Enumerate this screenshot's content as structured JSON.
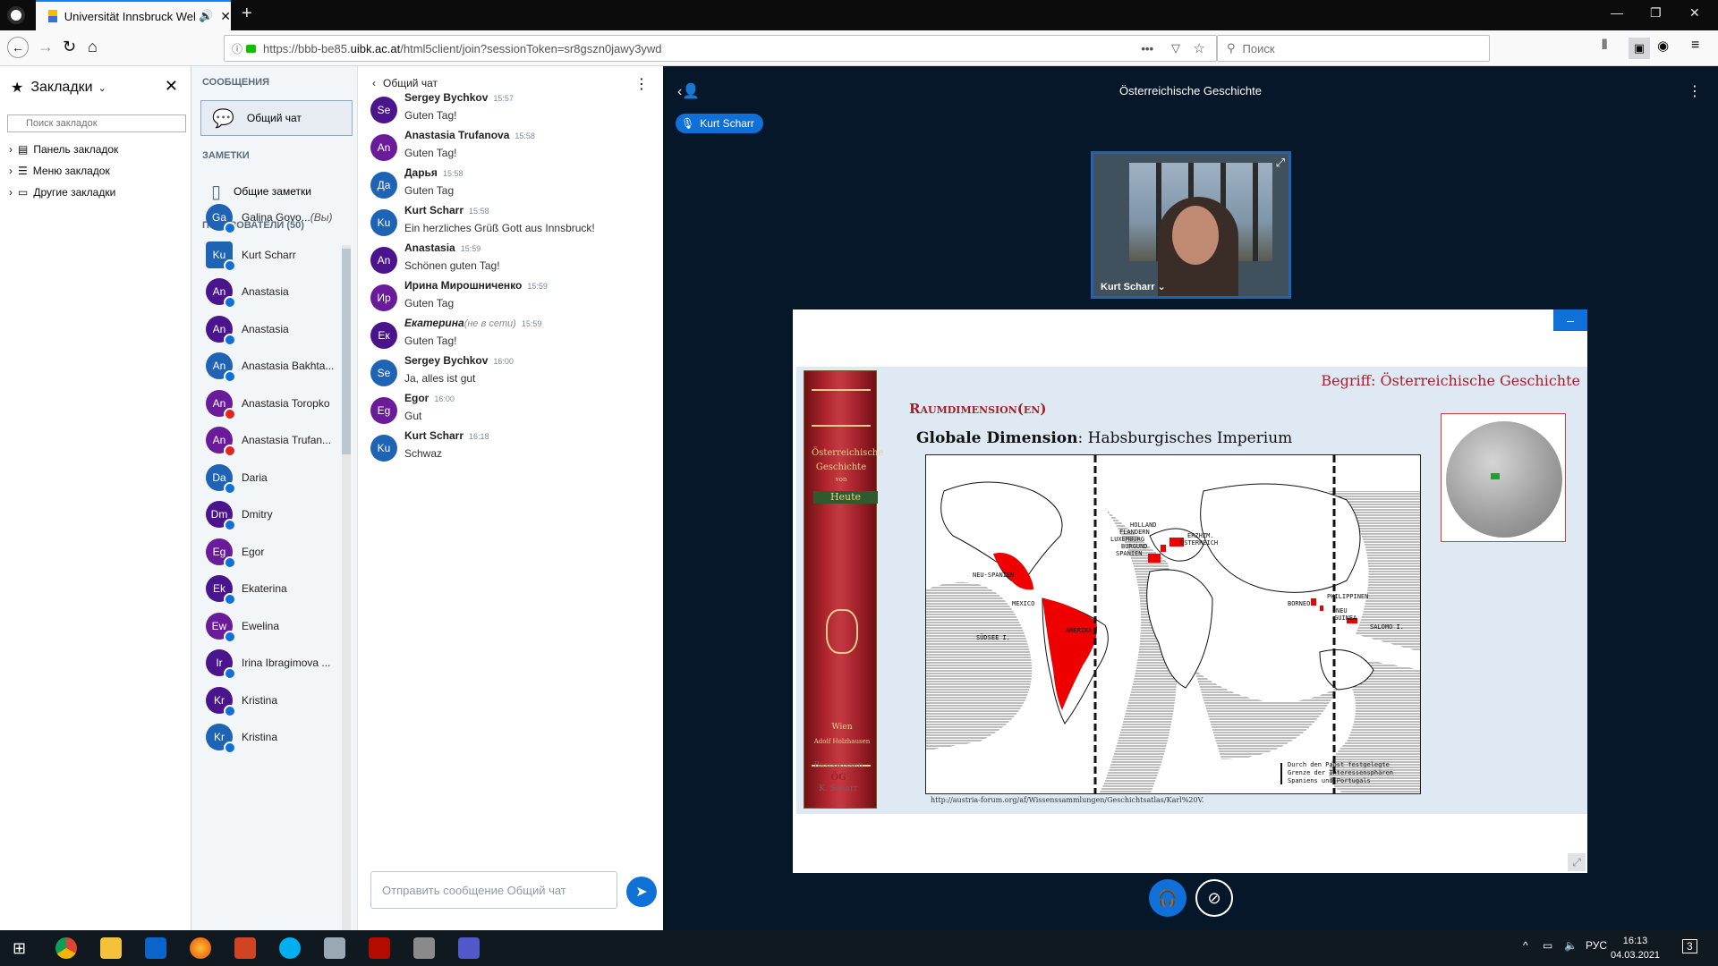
{
  "browser": {
    "tab_title": "Universität Innsbruck Webc",
    "url_prefix": "https://bbb-be85.",
    "url_host": "uibk.ac.at",
    "url_suffix": "/html5client/join?sessionToken=sr8gszn0jawy3ywd",
    "search_placeholder": "Поиск",
    "url_more": "•••"
  },
  "bookmarks": {
    "title": "Закладки",
    "search_placeholder": "Поиск закладок",
    "items": [
      "Панель закладок",
      "Меню закладок",
      "Другие закладки"
    ]
  },
  "bbb_left": {
    "messages_header": "СООБЩЕНИЯ",
    "public_chat": "Общий чат",
    "notes_header": "ЗАМЕТКИ",
    "shared_notes": "Общие заметки",
    "users_header": "ПОЛЬЗОВАТЕЛИ (50)",
    "users": [
      {
        "initials": "Ga",
        "name": "Galina Govo...",
        "suffix": "(Вы)",
        "color": "#1f63b5",
        "status": "blue"
      },
      {
        "initials": "Ku",
        "name": "Kurt Scharr",
        "suffix": "",
        "color": "#1f63b5",
        "status": "blue",
        "presenter": true
      },
      {
        "initials": "An",
        "name": "Anastasia",
        "suffix": "",
        "color": "#4a148c",
        "status": "blue"
      },
      {
        "initials": "An",
        "name": "Anastasia",
        "suffix": "",
        "color": "#4a148c",
        "status": "blue"
      },
      {
        "initials": "An",
        "name": "Anastasia Bakhta...",
        "suffix": "",
        "color": "#1f63b5",
        "status": "blue"
      },
      {
        "initials": "An",
        "name": "Anastasia Toropko",
        "suffix": "",
        "color": "#6a1b9a",
        "status": "red"
      },
      {
        "initials": "An",
        "name": "Anastasia Trufan...",
        "suffix": "",
        "color": "#6a1b9a",
        "status": "red"
      },
      {
        "initials": "Da",
        "name": "Daria",
        "suffix": "",
        "color": "#1f63b5",
        "status": "blue"
      },
      {
        "initials": "Dm",
        "name": "Dmitry",
        "suffix": "",
        "color": "#4a148c",
        "status": "blue"
      },
      {
        "initials": "Eg",
        "name": "Egor",
        "suffix": "",
        "color": "#6a1b9a",
        "status": "blue"
      },
      {
        "initials": "Ek",
        "name": "Ekaterina",
        "suffix": "",
        "color": "#4a148c",
        "status": "blue"
      },
      {
        "initials": "Ew",
        "name": "Ewelina",
        "suffix": "",
        "color": "#6a1b9a",
        "status": "blue"
      },
      {
        "initials": "Ir",
        "name": "Irina Ibragimova ...",
        "suffix": "",
        "color": "#4a148c",
        "status": "blue"
      },
      {
        "initials": "Kr",
        "name": "Kristina",
        "suffix": "",
        "color": "#4a148c",
        "status": "blue"
      },
      {
        "initials": "Kr",
        "name": "Kristina",
        "suffix": "",
        "color": "#1f63b5",
        "status": "blue"
      }
    ]
  },
  "chat": {
    "title": "Общий чат",
    "input_placeholder": "Отправить сообщение Общий чат",
    "messages": [
      {
        "initials": "Se",
        "name": "Sergey Bychkov",
        "time": "15:57",
        "text": "Guten Tag!",
        "color": "#4a148c",
        "offline": ""
      },
      {
        "initials": "An",
        "name": "Anastasia Trufanova",
        "time": "15:58",
        "text": "Guten Tag!",
        "color": "#6a1b9a",
        "offline": ""
      },
      {
        "initials": "Да",
        "name": "Дарья",
        "time": "15:58",
        "text": "Guten Tag",
        "color": "#1f63b5",
        "offline": ""
      },
      {
        "initials": "Ku",
        "name": "Kurt Scharr",
        "time": "15:58",
        "text": "Ein herzliches Grüß Gott aus Innsbruck!",
        "color": "#1f63b5",
        "offline": ""
      },
      {
        "initials": "An",
        "name": "Anastasia",
        "time": "15:59",
        "text": "Schönen guten Tag!",
        "color": "#4a148c",
        "offline": ""
      },
      {
        "initials": "Ир",
        "name": "Ирина Мирошниченко",
        "time": "15:59",
        "text": "Guten Tag",
        "color": "#6a1b9a",
        "offline": ""
      },
      {
        "initials": "Ек",
        "name": "Екатерина",
        "time": "15:59",
        "text": "Guten Tag!",
        "color": "#4a148c",
        "offline": "(не в сети)"
      },
      {
        "initials": "Se",
        "name": "Sergey Bychkov",
        "time": "16:00",
        "text": "Ja, alles ist gut",
        "color": "#1f63b5",
        "offline": ""
      },
      {
        "initials": "Eg",
        "name": "Egor",
        "time": "16:00",
        "text": "Gut",
        "color": "#6a1b9a",
        "offline": ""
      },
      {
        "initials": "Ku",
        "name": "Kurt Scharr",
        "time": "16:18",
        "text": "Schwaz",
        "color": "#1f63b5",
        "offline": ""
      }
    ]
  },
  "main": {
    "title": "Österreichische Geschichte",
    "talking": "Kurt Scharr",
    "webcam_label": "Kurt Scharr ⌄"
  },
  "slide": {
    "begriff": "Begriff: Österreichische Geschichte",
    "raum": "Raumdimension(en)",
    "glob_bold": "Globale Dimension",
    "glob_rest": ": Habsburgisches Imperium",
    "book_title_1": "Österreichische",
    "book_title_2": "Geschichte",
    "book_title_3": "von",
    "book_band": "Heute",
    "book_pub_1": "Wien",
    "book_pub_2": "Adolf Holzhausen",
    "basis_1": "Basiswissen",
    "basis_2": "ÖG",
    "basis_3": "K. Scharr",
    "source": "http://austria-forum.org/af/Wissenssammlungen/Geschichtsatlas/Karl%20V.",
    "map_labels": {
      "holland": "HOLLAND",
      "flandern": "FLANDERN",
      "luxemburg": "LUXEMBURG",
      "burgund": "BURGUND",
      "spanien": "SPANIEN",
      "erzhm": "ERZHZM.",
      "oesterreich": "ÖSTERREICH",
      "neuspanien": "NEU-SPANIEN",
      "mexico": "MEXICO",
      "amerika": "AMERIKA",
      "suedsee": "SÜDSEE I.",
      "borneo": "BORNEO",
      "philippinen": "PHILIPPINEN",
      "neu": "NEU",
      "guinea": "GUINEA",
      "salomo": "SALOMO I."
    },
    "legend_1": "Durch den Papst festgelegte",
    "legend_2": "Grenze der Interessensphären",
    "legend_3": "Spaniens und Portugals"
  },
  "taskbar": {
    "lang": "РУС",
    "time": "16:13",
    "date": "04.03.2021",
    "notif": "3"
  }
}
